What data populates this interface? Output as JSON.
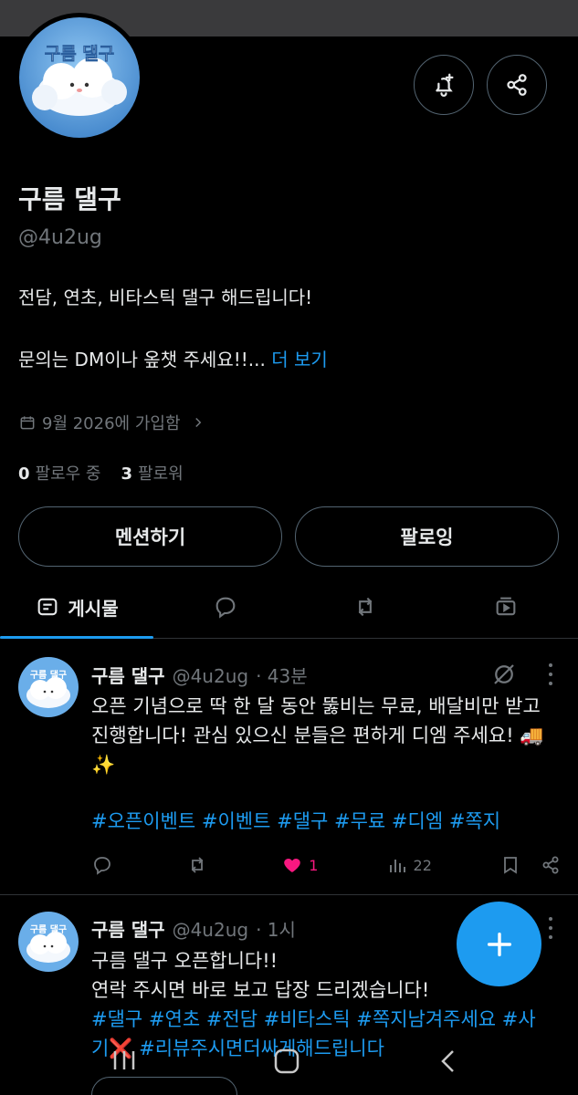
{
  "profile": {
    "avatar_text": "구름 댈구",
    "display_name": "구름 댈구",
    "handle": "@4u2ug",
    "bio_line1": "전담, 연초, 비타스틱 댈구 해드립니다!",
    "bio_line2": "문의는 DM이나 옾챗 주세요!!...",
    "bio_more": "더 보기",
    "joined": "9월 2026에 가입함",
    "following_count": "0",
    "following_label": "팔로우 중",
    "followers_count": "3",
    "followers_label": "팔로워"
  },
  "buttons": {
    "mention": "멘션하기",
    "following": "팔로잉"
  },
  "tabs": {
    "posts": "게시물"
  },
  "posts": [
    {
      "name": "구름 댈구",
      "handle": "@4u2ug",
      "time": "· 43분",
      "text": "오픈 기념으로 딱 한 달 동안 뚫비는 무료, 배달비만 받고 진행합니다! 관심 있으신 분들은 편하게 디엠 주세요! 🚚✨",
      "hashtags": "#오픈이벤트 #이벤트 #댈구 #무료 #디엠 #쪽지",
      "reply_count": "",
      "retweet_count": "",
      "like_count": "1",
      "view_count": "22"
    },
    {
      "name": "구름 댈구",
      "handle": "@4u2ug",
      "time": "· 1시",
      "text": "구름 댈구 오픈합니다!!\n연락 주시면 바로 보고 답장 드리겠습니다!",
      "hashtags": "#댈구 #연초 #전담 #비타스틱 #쪽지남겨주세요 #사기❌ #리뷰주시면더싸게해드립니다"
    }
  ],
  "colors": {
    "accent": "#1d9bf0",
    "like": "#f91880",
    "muted": "#71767b",
    "border": "#2f3336"
  },
  "icons": {
    "notify": "bell-plus-icon",
    "share": "share-icon",
    "compose": "plus-icon"
  }
}
